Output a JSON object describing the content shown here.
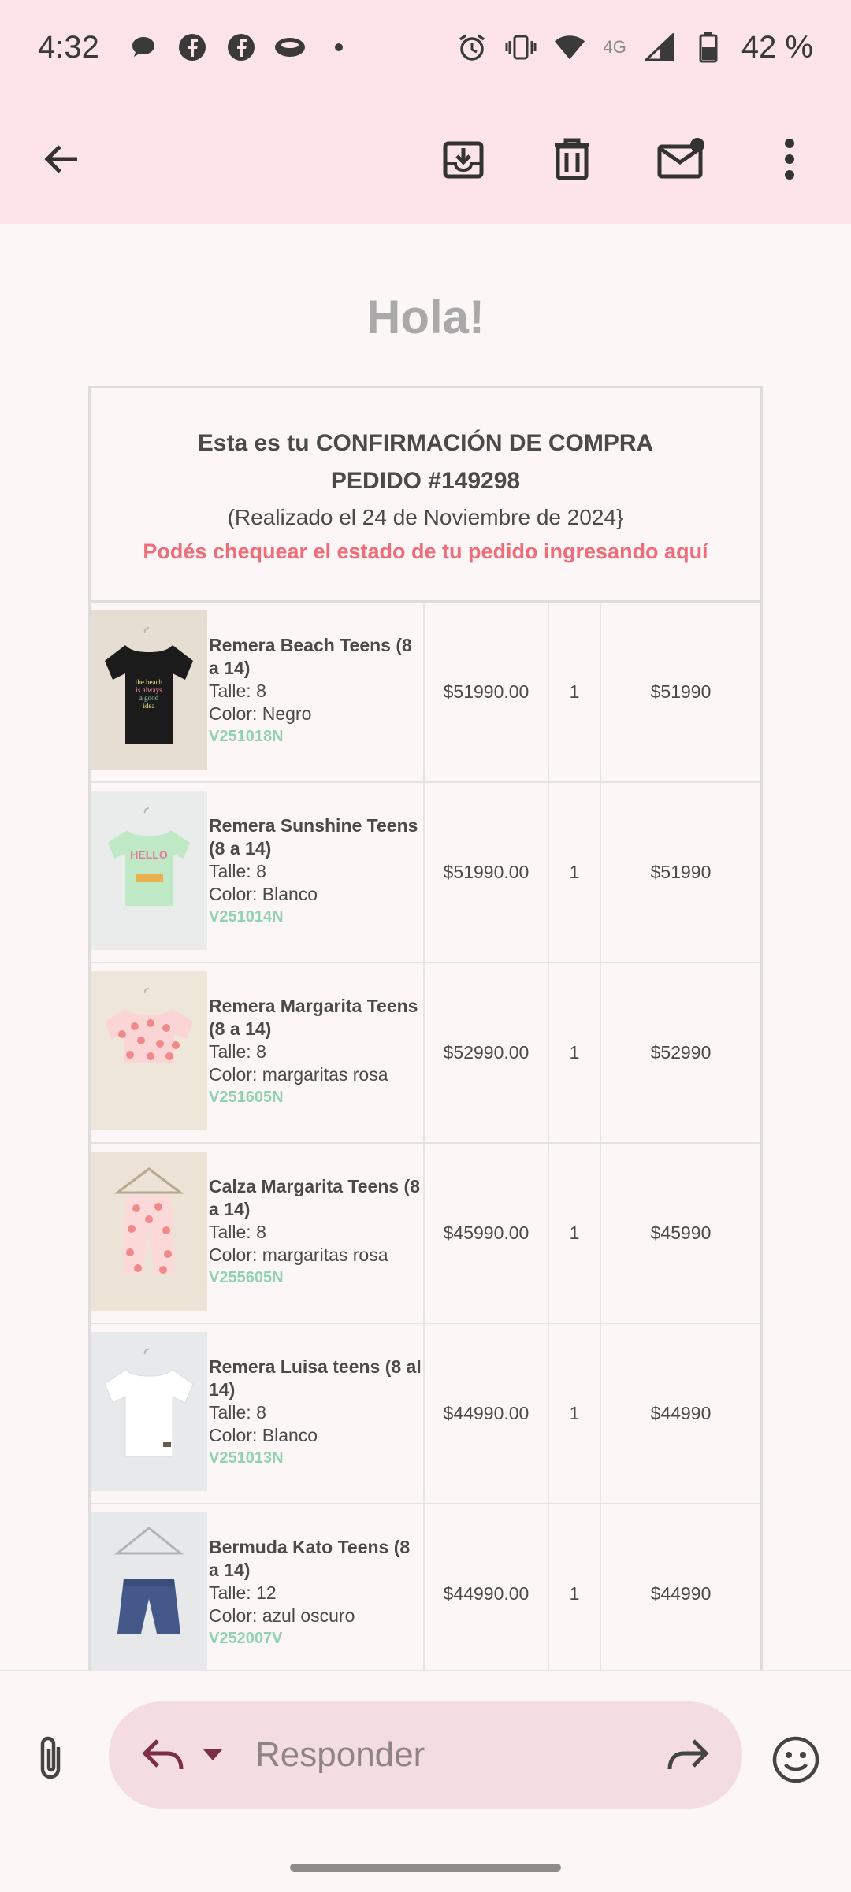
{
  "status_bar": {
    "time": "4:32",
    "network": "4G",
    "battery": "42 %",
    "notification_icons": [
      "chat-bubble-icon",
      "facebook-icon",
      "facebook-icon",
      "eye-app-icon",
      "dot-icon"
    ],
    "system_icons": [
      "alarm-icon",
      "vibrate-icon",
      "wifi-icon",
      "signal-icon",
      "battery-icon"
    ]
  },
  "toolbar": {
    "icons": [
      "back-arrow-icon",
      "archive-icon",
      "delete-icon",
      "mark-unread-icon",
      "more-vert-icon"
    ]
  },
  "email": {
    "greeting": "Hola!",
    "confirmation": {
      "line1": "Esta es tu CONFIRMACIÓN DE COMPRA",
      "line2": "PEDIDO #149298",
      "date": "(Realizado el 24 de Noviembre de 2024}",
      "link": "Podés chequear el estado de tu pedido ingresando aquí"
    },
    "items": [
      {
        "name": "Remera Beach Teens (8 a 14)",
        "size": "Talle: 8",
        "color": "Color: Negro",
        "sku": "V251018N",
        "price": "$51990.00",
        "qty": "1",
        "total": "$51990"
      },
      {
        "name": "Remera Sunshine Teens (8 a 14)",
        "size": "Talle: 8",
        "color": "Color: Blanco",
        "sku": "V251014N",
        "price": "$51990.00",
        "qty": "1",
        "total": "$51990"
      },
      {
        "name": "Remera Margarita Teens (8 a 14)",
        "size": "Talle: 8",
        "color": "Color: margaritas rosa",
        "sku": "V251605N",
        "price": "$52990.00",
        "qty": "1",
        "total": "$52990"
      },
      {
        "name": "Calza Margarita Teens (8 a 14)",
        "size": "Talle: 8",
        "color": "Color: margaritas rosa",
        "sku": "V255605N",
        "price": "$45990.00",
        "qty": "1",
        "total": "$45990"
      },
      {
        "name": "Remera Luisa teens (8 al 14)",
        "size": "Talle: 8",
        "color": "Color: Blanco",
        "sku": "V251013N",
        "price": "$44990.00",
        "qty": "1",
        "total": "$44990"
      },
      {
        "name": "Bermuda Kato Teens (8 a 14)",
        "size": "Talle: 12",
        "color": "Color: azul oscuro",
        "sku": "V252007V",
        "price": "$44990.00",
        "qty": "1",
        "total": "$44990"
      }
    ],
    "product_image_text": {
      "beach_tee": [
        "the beach",
        "is always",
        "a good",
        "idea"
      ],
      "sunshine_tee": "HELLO"
    }
  },
  "reply_bar": {
    "placeholder": "Responder",
    "icons": [
      "paperclip-icon",
      "reply-icon",
      "chevron-down-icon",
      "forward-icon",
      "emoji-icon"
    ]
  },
  "colors": {
    "header_bg": "#fde4ea",
    "page_bg": "#fdf6f6",
    "link_red": "#ee6d78",
    "sku_green": "#8fd3b0",
    "reply_pill": "#f3dde2"
  }
}
